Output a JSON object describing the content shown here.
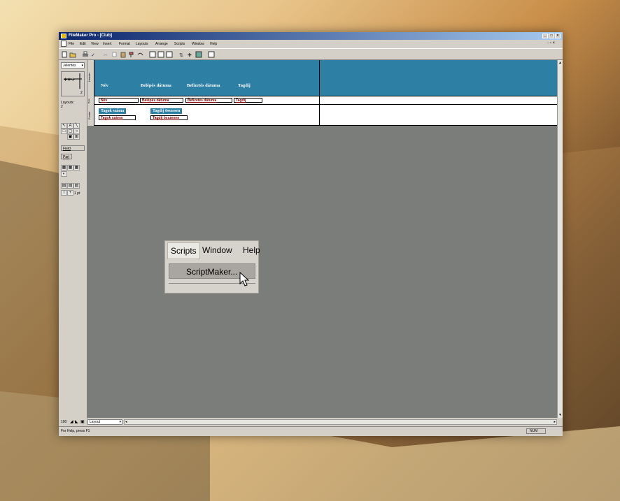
{
  "app": {
    "title": "FileMaker Pro - [Club]"
  },
  "menu": {
    "items": [
      "File",
      "Edit",
      "View",
      "Insert",
      "Format",
      "Layouts",
      "Arrange",
      "Scripts",
      "Window",
      "Help"
    ]
  },
  "left_panel": {
    "layout_dropdown": "Jelentés",
    "layout_label": "Layouts:",
    "layout_count": "2",
    "book_page": "2",
    "field_label": "Field",
    "part_label": "Part",
    "pt_label": "1 pt"
  },
  "parts": {
    "header": "Header",
    "body": "Body",
    "footer": "Footer"
  },
  "header_labels": [
    "Név",
    "Belépés dátuma",
    "Befizetés dátuma",
    "Tagdíj"
  ],
  "body_fields": [
    "Név",
    "Belépés dátuma",
    "Befizetés dátuma",
    "Tagdíj"
  ],
  "footer": {
    "labels": [
      "Tagok száma",
      "Tagdíj összesen"
    ],
    "fields": [
      "Tagok száma",
      "Tagdíj összesen"
    ]
  },
  "status": {
    "zoom": "100",
    "mode": "Layout",
    "help": "For Help, press F1",
    "num": "NUM"
  },
  "popup": {
    "menus": [
      "Scripts",
      "Window",
      "Help"
    ],
    "item": "ScriptMaker..."
  },
  "colors": {
    "band_blue": "#2d7fa4",
    "canvas_gray": "#7a7d79"
  }
}
